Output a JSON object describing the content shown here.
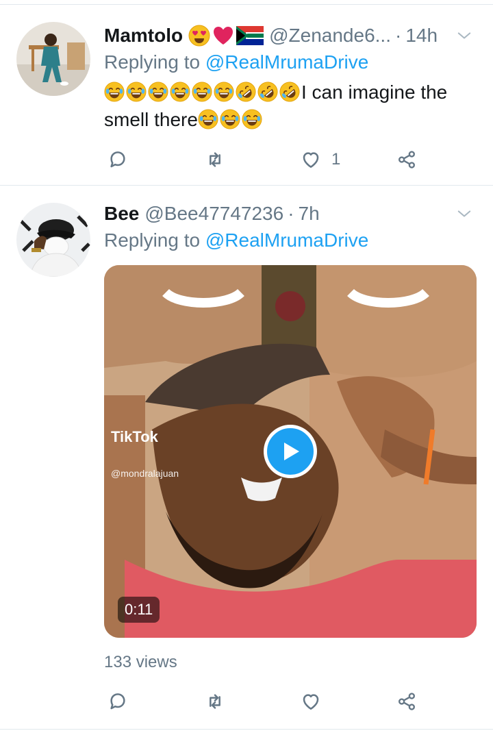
{
  "tweets": [
    {
      "name": "Mamtolo",
      "name_emojis": [
        "heart-eyes",
        "red-heart",
        "south-africa-flag"
      ],
      "handle": "@Zenande6...",
      "separator": "·",
      "time": "14h",
      "replying_prefix": "Replying to",
      "replying_to": "@RealMrumaDrive",
      "text_emojis_before": [
        "joy",
        "joy",
        "joy",
        "joy",
        "joy",
        "joy",
        "rofl",
        "rofl",
        "rofl"
      ],
      "text": "I can imagine the smell there",
      "text_emojis_after": [
        "joy",
        "joy",
        "joy"
      ],
      "actions": {
        "reply": "",
        "retweet": "",
        "like": "1",
        "share": ""
      }
    },
    {
      "name": "Bee",
      "handle": "@Bee47747236",
      "separator": "·",
      "time": "7h",
      "replying_prefix": "Replying to",
      "replying_to": "@RealMrumaDrive",
      "video": {
        "duration": "0:11",
        "watermark": "TikTok",
        "watermark_user": "@mondralajuan"
      },
      "views": "133 views",
      "actions": {
        "reply": "",
        "retweet": "",
        "like": "",
        "share": ""
      }
    }
  ],
  "colors": {
    "link": "#1da1f2",
    "secondary_text": "#657786",
    "divider": "#e1e8ed",
    "emoji_yellow": "#f7c021"
  }
}
